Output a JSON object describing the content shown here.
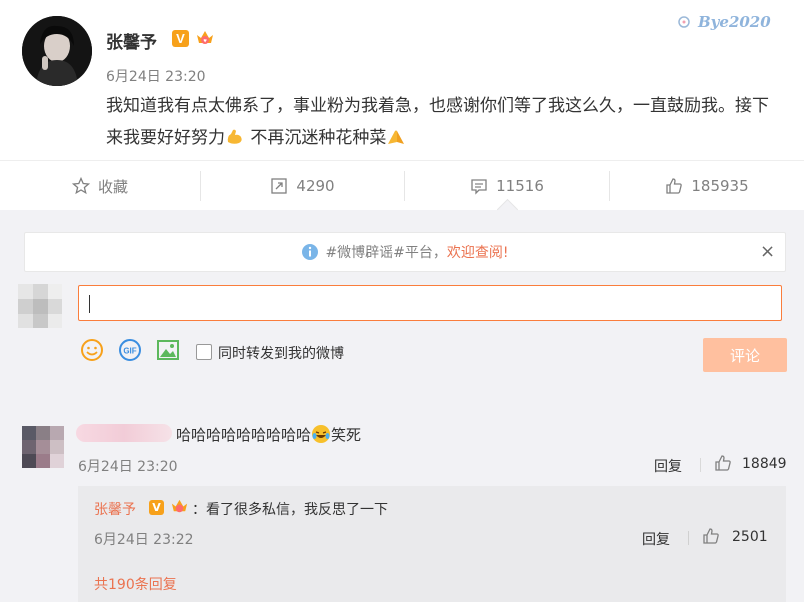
{
  "post": {
    "author": "张馨予",
    "verified_badge": "V",
    "timestamp": "6月24日 23:20",
    "text_part1": "我知道我有点太佛系了，事业粉为我着急，也感谢你们等了我这么久，一直鼓励我。接下来我要好好努力",
    "text_part2": " 不再沉迷种花种菜",
    "watermark": "Bye2020"
  },
  "actions": {
    "favorite": "收藏",
    "repost_count": "4290",
    "comment_count": "11516",
    "like_count": "185935"
  },
  "notice": {
    "text": "#微博辟谣#平台，",
    "highlight": "欢迎查阅!",
    "close": "×"
  },
  "composer": {
    "repost_option": "同时转发到我的微博",
    "submit": "评论",
    "gif_label": "GIF"
  },
  "comment": {
    "text": "哈哈哈哈哈哈哈哈哈",
    "text_suffix": "笑死",
    "time": "6月24日 23:20",
    "reply": "回复",
    "likes": "18849"
  },
  "reply": {
    "author": "张馨予",
    "verified_badge": "V",
    "text": "：看了很多私信，我反思了一下",
    "time": "6月24日 23:22",
    "reply": "回复",
    "likes": "2501",
    "more": "共190条回复"
  },
  "colors": {
    "accent": "#eb7350",
    "input_border": "#fa7d3c",
    "submit_disabled": "#ffc09f",
    "verified": "#f7a11b"
  }
}
